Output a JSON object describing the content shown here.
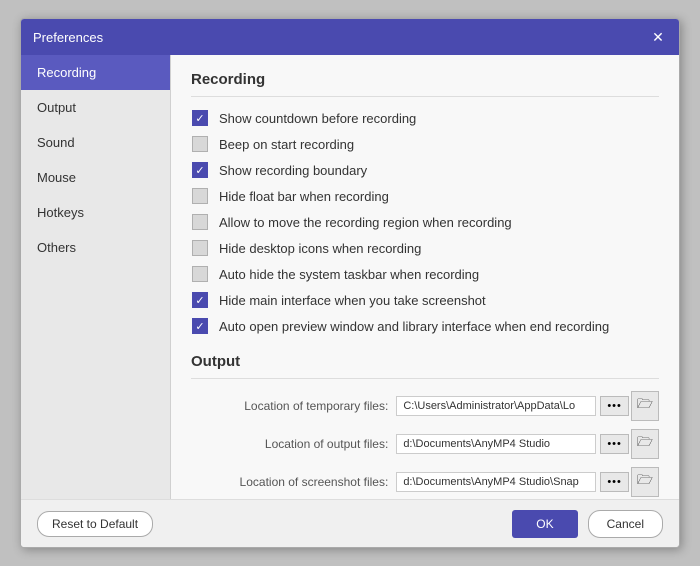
{
  "dialog": {
    "title": "Preferences",
    "close_label": "✕"
  },
  "sidebar": {
    "items": [
      {
        "id": "recording",
        "label": "Recording",
        "active": true
      },
      {
        "id": "output",
        "label": "Output",
        "active": false
      },
      {
        "id": "sound",
        "label": "Sound",
        "active": false
      },
      {
        "id": "mouse",
        "label": "Mouse",
        "active": false
      },
      {
        "id": "hotkeys",
        "label": "Hotkeys",
        "active": false
      },
      {
        "id": "others",
        "label": "Others",
        "active": false
      }
    ]
  },
  "recording_section": {
    "title": "Recording",
    "checkboxes": [
      {
        "id": "show-countdown",
        "label": "Show countdown before recording",
        "checked": true
      },
      {
        "id": "beep-on-start",
        "label": "Beep on start recording",
        "checked": false
      },
      {
        "id": "show-boundary",
        "label": "Show recording boundary",
        "checked": true
      },
      {
        "id": "hide-float-bar",
        "label": "Hide float bar when recording",
        "checked": false
      },
      {
        "id": "allow-move",
        "label": "Allow to move the recording region when recording",
        "checked": false
      },
      {
        "id": "hide-desktop-icons",
        "label": "Hide desktop icons when recording",
        "checked": false
      },
      {
        "id": "auto-hide-taskbar",
        "label": "Auto hide the system taskbar when recording",
        "checked": false
      },
      {
        "id": "hide-main-interface",
        "label": "Hide main interface when you take screenshot",
        "checked": true
      },
      {
        "id": "auto-open-preview",
        "label": "Auto open preview window and library interface when end recording",
        "checked": true
      }
    ]
  },
  "output_section": {
    "title": "Output",
    "fields": [
      {
        "id": "temp-files",
        "label": "Location of temporary files:",
        "value": "C:\\Users\\Administrator\\AppData\\Lo"
      },
      {
        "id": "output-files",
        "label": "Location of output files:",
        "value": "d:\\Documents\\AnyMP4 Studio"
      },
      {
        "id": "screenshot-files",
        "label": "Location of screenshot files:",
        "value": "d:\\Documents\\AnyMP4 Studio\\Snap"
      }
    ],
    "dots_label": "•••",
    "folder_icon": "🗁"
  },
  "footer": {
    "reset_label": "Reset to Default",
    "ok_label": "OK",
    "cancel_label": "Cancel"
  }
}
